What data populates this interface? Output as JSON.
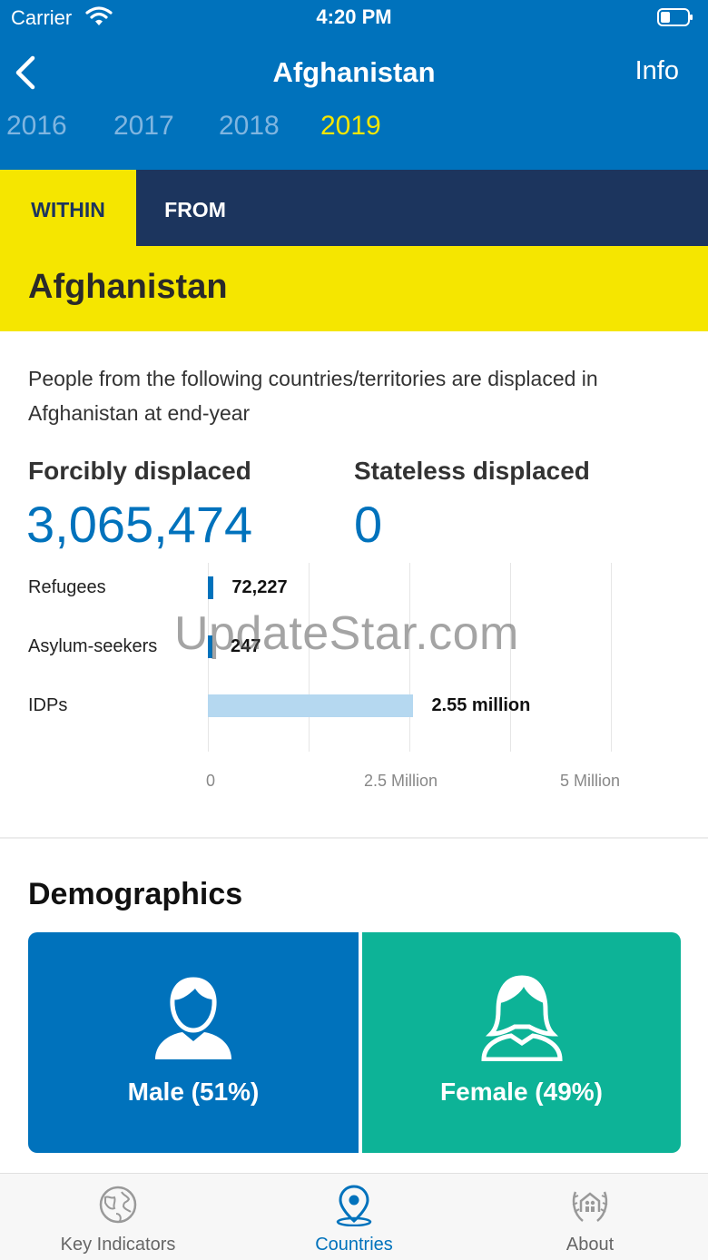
{
  "status_bar": {
    "carrier": "Carrier",
    "time": "4:20 PM"
  },
  "nav": {
    "title": "Afghanistan",
    "info_label": "Info"
  },
  "years": [
    {
      "label": "2016",
      "active": false
    },
    {
      "label": "2017",
      "active": false
    },
    {
      "label": "2018",
      "active": false
    },
    {
      "label": "2019",
      "active": true
    }
  ],
  "tabs": {
    "within": "WITHIN",
    "from": "FROM",
    "active": "within"
  },
  "country": "Afghanistan",
  "description": "People from the following countries/territories are displaced in Afghanistan at end-year",
  "stats": {
    "forcibly_label": "Forcibly displaced",
    "forcibly_value": "3,065,474",
    "stateless_label": "Stateless displaced",
    "stateless_value": "0"
  },
  "chart_data": {
    "type": "bar",
    "orientation": "horizontal",
    "categories": [
      "Refugees",
      "Asylum-seekers",
      "IDPs"
    ],
    "values": [
      72227,
      247,
      2550000
    ],
    "value_labels": [
      "72,227",
      "247",
      "2.55 million"
    ],
    "x_ticks": [
      "0",
      "2.5 Million",
      "5 Million"
    ],
    "xlim": [
      0,
      5500000
    ],
    "colors": [
      "#0072bc",
      "#0072bc",
      "#b5d8f0"
    ],
    "grid": true
  },
  "watermark": "UpdateStar.com",
  "demographics": {
    "title": "Demographics",
    "male_label": "Male (51%)",
    "female_label": "Female (49%)",
    "male_color": "#0072bc",
    "female_color": "#0db397"
  },
  "tabbar": {
    "items": [
      {
        "label": "Key Indicators",
        "icon": "globe-icon",
        "active": false
      },
      {
        "label": "Countries",
        "icon": "location-pin-icon",
        "active": true
      },
      {
        "label": "About",
        "icon": "unhcr-logo-icon",
        "active": false
      }
    ]
  },
  "colors": {
    "brand_blue": "#0072bc",
    "navy": "#1c355e",
    "yellow": "#f5e600"
  }
}
